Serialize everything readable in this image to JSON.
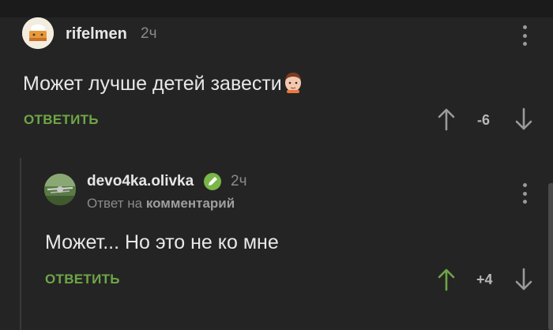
{
  "comment1": {
    "author": "rifelmen",
    "time": "2ч",
    "text": "Может лучше детей завести",
    "reply_label": "ОТВЕТИТЬ",
    "score": "-6"
  },
  "comment2": {
    "author": "devo4ka.olivka",
    "time": "2ч",
    "reply_prefix": "Ответ на",
    "reply_target": "комментарий",
    "text": "Может... Но это не ко мне",
    "reply_label": "ОТВЕТИТЬ",
    "score": "+4"
  },
  "colors": {
    "background": "#242424",
    "accent_green": "#6ea646",
    "upvote_active": "#6ea646",
    "text": "#e8e8e8",
    "muted": "#8a8a8a"
  },
  "icons": {
    "upvote": "arrow-up-icon",
    "downvote": "arrow-down-icon",
    "menu": "kebab-menu-icon",
    "verified": "verified-pencil-icon",
    "emoji": "boy-face-emoji"
  }
}
